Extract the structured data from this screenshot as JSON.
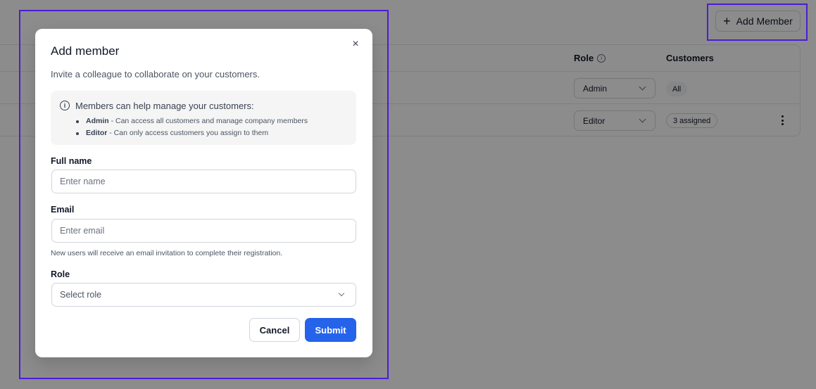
{
  "background": {
    "add_member_label": "Add Member",
    "add_member_icon": "plus-icon",
    "table": {
      "columns": {
        "role": "Role",
        "customers": "Customers"
      },
      "rows": [
        {
          "role": "Admin",
          "customers": "All"
        },
        {
          "role": "Editor",
          "customers": "3 assigned"
        }
      ]
    }
  },
  "modal": {
    "title": "Add member",
    "description": "Invite a colleague to collaborate on your customers.",
    "info": {
      "heading": "Members can help manage your customers:",
      "items": [
        {
          "role": "Admin",
          "text": " - Can access all customers and manage company members"
        },
        {
          "role": "Editor",
          "text": " - Can only access customers you assign to them"
        }
      ]
    },
    "fields": {
      "full_name": {
        "label": "Full name",
        "placeholder": "Enter name",
        "value": ""
      },
      "email": {
        "label": "Email",
        "placeholder": "Enter email",
        "value": "",
        "helper": "New users will receive an email invitation to complete their registration."
      },
      "role": {
        "label": "Role",
        "placeholder": "Select role"
      }
    },
    "buttons": {
      "cancel": "Cancel",
      "submit": "Submit"
    },
    "close_symbol": "×"
  },
  "colors": {
    "accent": "#2563eb",
    "highlight": "#4c1dd4",
    "overlay": "rgba(0,0,0,0.45)"
  }
}
